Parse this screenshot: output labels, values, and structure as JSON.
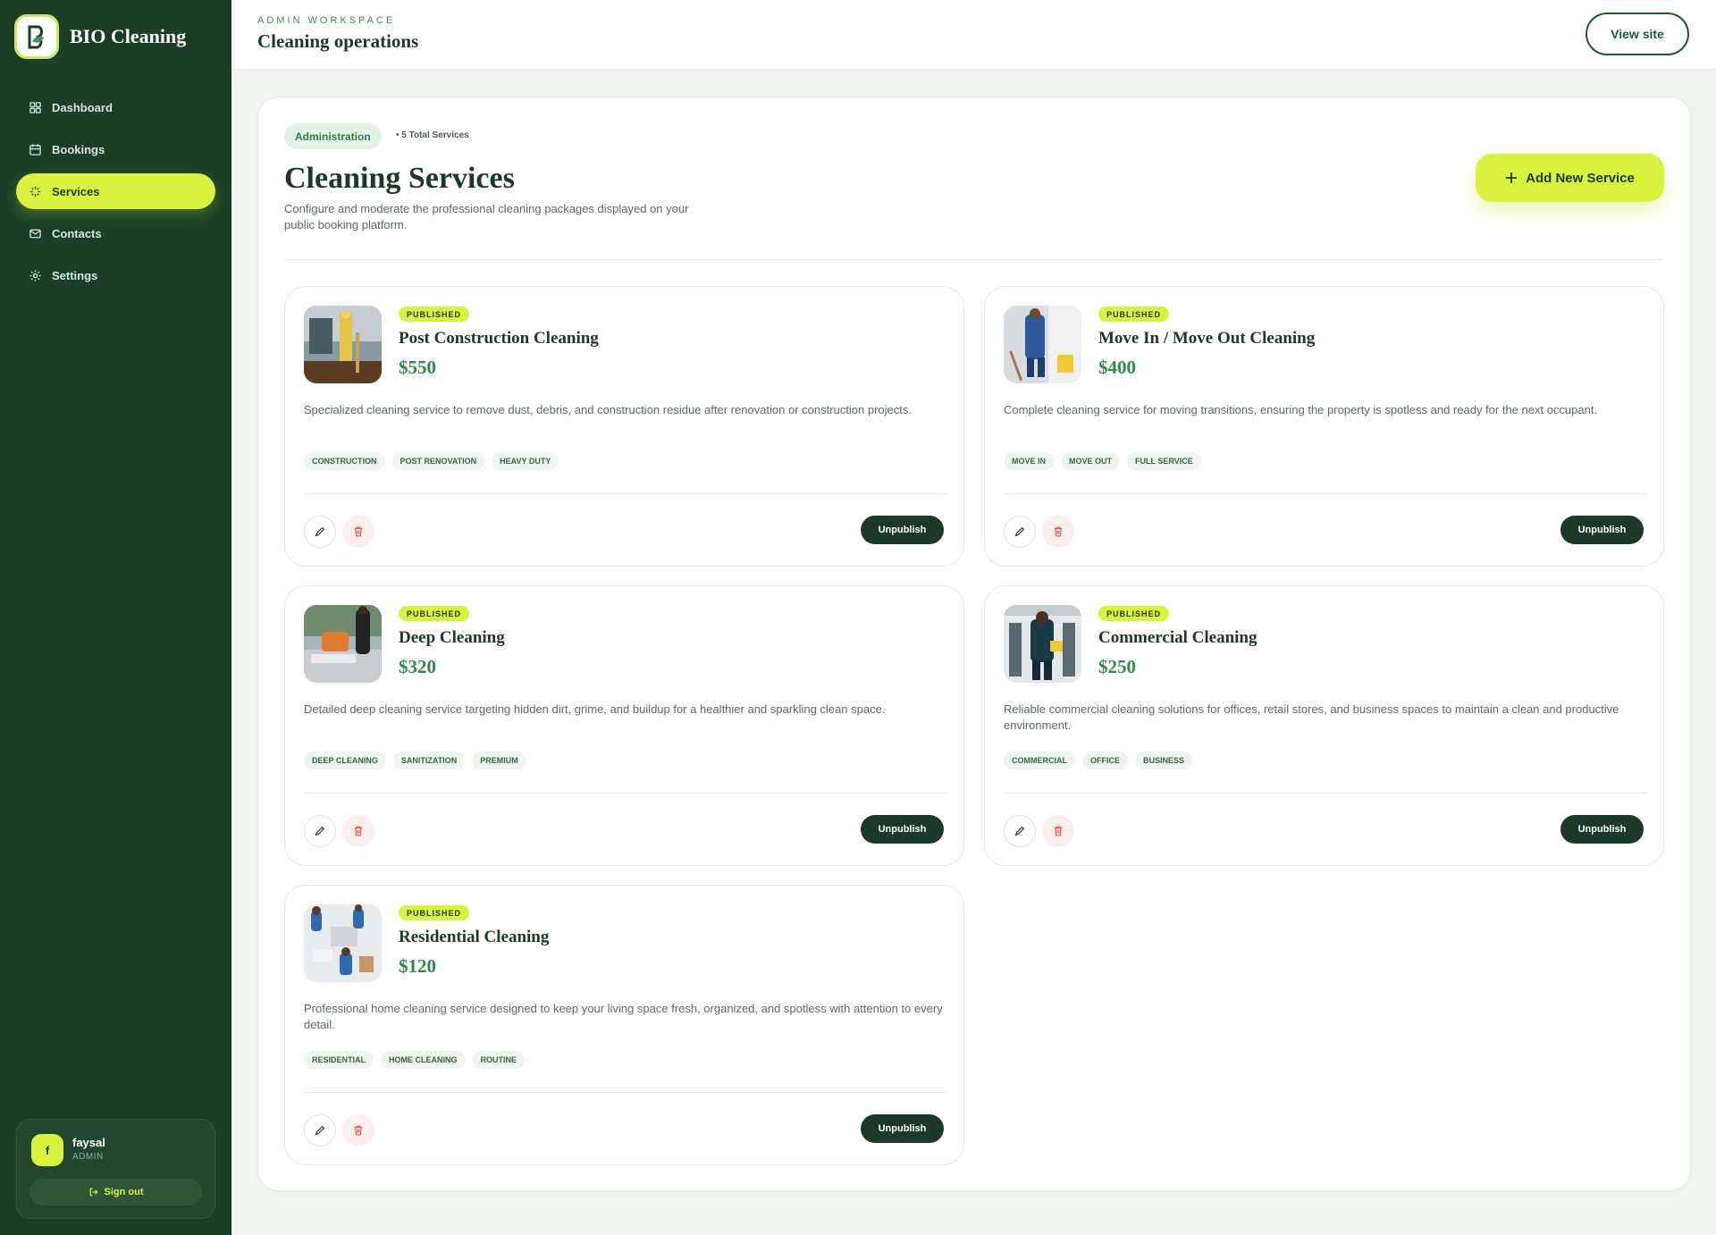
{
  "brand": {
    "name": "BIO Cleaning"
  },
  "nav": [
    {
      "label": "Dashboard",
      "icon": "dashboard-icon",
      "active": false
    },
    {
      "label": "Bookings",
      "icon": "calendar-icon",
      "active": false
    },
    {
      "label": "Services",
      "icon": "sparkle-icon",
      "active": true
    },
    {
      "label": "Contacts",
      "icon": "mail-icon",
      "active": false
    },
    {
      "label": "Settings",
      "icon": "gear-icon",
      "active": false
    }
  ],
  "user": {
    "avatar_initial": "f",
    "name": "faysal",
    "role": "ADMIN",
    "signout_label": "Sign out"
  },
  "header": {
    "eyebrow": "ADMIN WORKSPACE",
    "title": "Cleaning operations",
    "view_site_label": "View site"
  },
  "main": {
    "pill": "Administration",
    "total": "• 5 Total Services",
    "title": "Cleaning Services",
    "description": "Configure and moderate the professional cleaning packages displayed on your public booking platform.",
    "add_button": "Add New Service"
  },
  "services": [
    {
      "status": "PUBLISHED",
      "title": "Post Construction Cleaning",
      "price": "$550",
      "description": "Specialized cleaning service to remove dust, debris, and construction residue after renovation or construction projects.",
      "tags": [
        "CONSTRUCTION",
        "POST RENOVATION",
        "HEAVY DUTY"
      ],
      "action": "Unpublish"
    },
    {
      "status": "PUBLISHED",
      "title": "Move In / Move Out Cleaning",
      "price": "$400",
      "description": "Complete cleaning service for moving transitions, ensuring the property is spotless and ready for the next occupant.",
      "tags": [
        "MOVE IN",
        "MOVE OUT",
        "FULL SERVICE"
      ],
      "action": "Unpublish"
    },
    {
      "status": "PUBLISHED",
      "title": "Deep Cleaning",
      "price": "$320",
      "description": "Detailed deep cleaning service targeting hidden dirt, grime, and buildup for a healthier and sparkling clean space.",
      "tags": [
        "DEEP CLEANING",
        "SANITIZATION",
        "PREMIUM"
      ],
      "action": "Unpublish"
    },
    {
      "status": "PUBLISHED",
      "title": "Commercial Cleaning",
      "price": "$250",
      "description": "Reliable commercial cleaning solutions for offices, retail stores, and business spaces to maintain a clean and productive environment.",
      "tags": [
        "COMMERCIAL",
        "OFFICE",
        "BUSINESS"
      ],
      "action": "Unpublish"
    },
    {
      "status": "PUBLISHED",
      "title": "Residential Cleaning",
      "price": "$120",
      "description": "Professional home cleaning service designed to keep your living space fresh, organized, and spotless with attention to every detail.",
      "tags": [
        "RESIDENTIAL",
        "HOME CLEANING",
        "ROUTINE"
      ],
      "action": "Unpublish"
    }
  ],
  "colors": {
    "sidebar": "#1b3f26",
    "accent": "#d9f23d",
    "primary_dark": "#1b3a26",
    "price": "#2c8a4a"
  }
}
